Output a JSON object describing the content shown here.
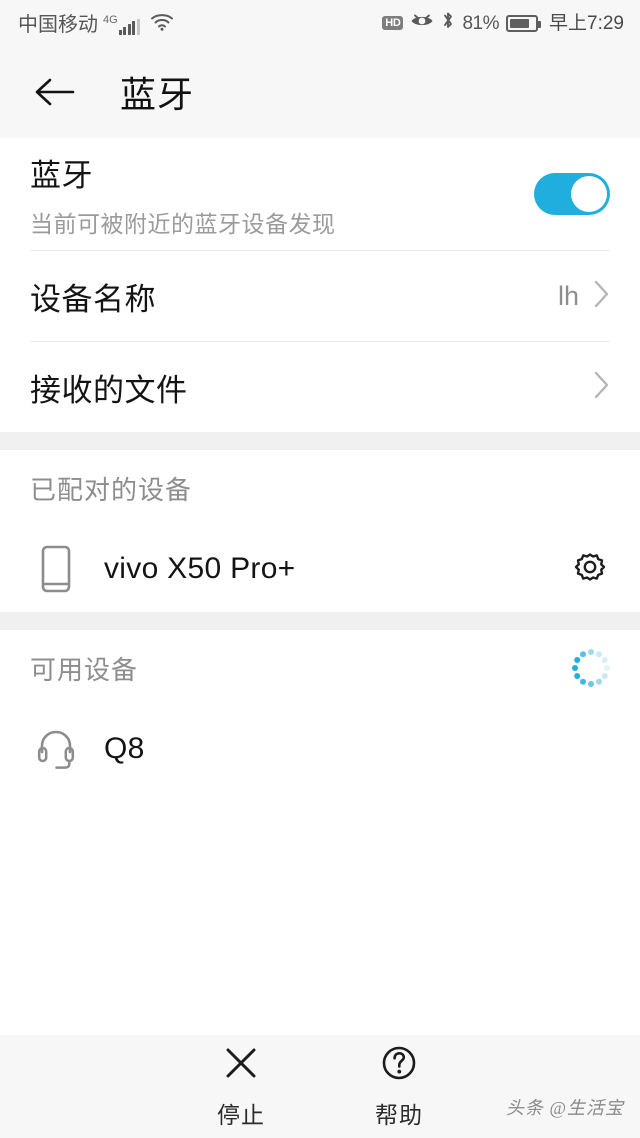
{
  "status_bar": {
    "carrier": "中国移动",
    "network_type": "4G",
    "signal_icon": "signal-bars-icon",
    "wifi_icon": "wifi-icon",
    "hd_badge": "HD",
    "eye_comfort_icon": "eye-comfort-icon",
    "bluetooth_icon": "bluetooth-icon",
    "battery_percent": "81%",
    "battery_icon": "battery-icon",
    "time": "早上7:29"
  },
  "header": {
    "back_icon": "back-arrow-icon",
    "title": "蓝牙"
  },
  "bluetooth_toggle": {
    "title": "蓝牙",
    "subtitle": "当前可被附近的蓝牙设备发现",
    "state": "on"
  },
  "rows": [
    {
      "label": "设备名称",
      "value": "lh",
      "chevron": "chevron-right-icon"
    },
    {
      "label": "接收的文件",
      "value": "",
      "chevron": "chevron-right-icon"
    }
  ],
  "paired_section": {
    "title": "已配对的设备",
    "devices": [
      {
        "name": "vivo X50 Pro+",
        "icon": "phone-icon",
        "action_icon": "gear-icon"
      }
    ]
  },
  "available_section": {
    "title": "可用设备",
    "spinner_icon": "loading-spinner-icon",
    "devices": [
      {
        "name": "Q8",
        "icon": "headset-icon"
      }
    ]
  },
  "bottom_bar": {
    "actions": [
      {
        "label": "停止",
        "icon": "close-x-icon"
      },
      {
        "label": "帮助",
        "icon": "question-circle-icon"
      }
    ],
    "watermark": "头条 @生活宝"
  },
  "colors": {
    "accent": "#1faedd",
    "bar_background": "#f7f7f7",
    "band": "#f0f0f0",
    "primary_text": "#141414",
    "secondary_text": "#8d8d8d"
  }
}
